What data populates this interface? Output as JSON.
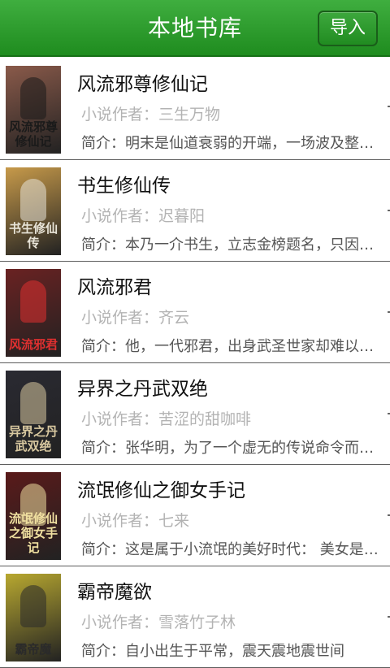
{
  "header": {
    "title": "本地书库",
    "import_label": "导入"
  },
  "books": [
    {
      "title": "风流邪尊修仙记",
      "author": "小说作者：三生万物",
      "summary": "简介：明末是仙道衰弱的开端，一场波及整个修仙界的浩劫",
      "cover_text": "风流邪尊修仙记",
      "cover_bg": "#8a5a4a",
      "cover_fg": "#1a1a1a"
    },
    {
      "title": "书生修仙传",
      "author": "小说作者：迟暮阳",
      "summary": "简介：本乃一介书生，立志金榜题名，只因一场变故",
      "cover_text": "书生修仙传",
      "cover_bg": "#c79a4a",
      "cover_fg": "#e8e4d8"
    },
    {
      "title": "风流邪君",
      "author": "小说作者：齐云",
      "summary": "简介：他，一代邪君，出身武圣世家却难以修炼",
      "cover_text": "风流邪君",
      "cover_bg": "#6a2222",
      "cover_fg": "#e03030"
    },
    {
      "title": "异界之丹武双绝",
      "author": "小说作者：苦涩的甜咖啡",
      "summary": "简介：张华明，为了一个虚无的传说命令而穿越异界",
      "cover_text": "异界之丹武双绝",
      "cover_bg": "#2a2a32",
      "cover_fg": "#d8c8a0"
    },
    {
      "title": "流氓修仙之御女手记",
      "author": "小说作者：七来",
      "summary": "简介：这是属于小流氓的美好时代： 美女是他的最爱",
      "cover_text": "流氓修仙之御女手记",
      "cover_bg": "#5a1a1a",
      "cover_fg": "#f0e0a0"
    },
    {
      "title": "霸帝魔欲",
      "author": "小说作者：雪落竹子林",
      "summary": "简介：自小出生于平常，震天震地震世间",
      "cover_text": "霸帝魔",
      "cover_bg": "#b8a830",
      "cover_fg": "#2a2a2a"
    }
  ]
}
